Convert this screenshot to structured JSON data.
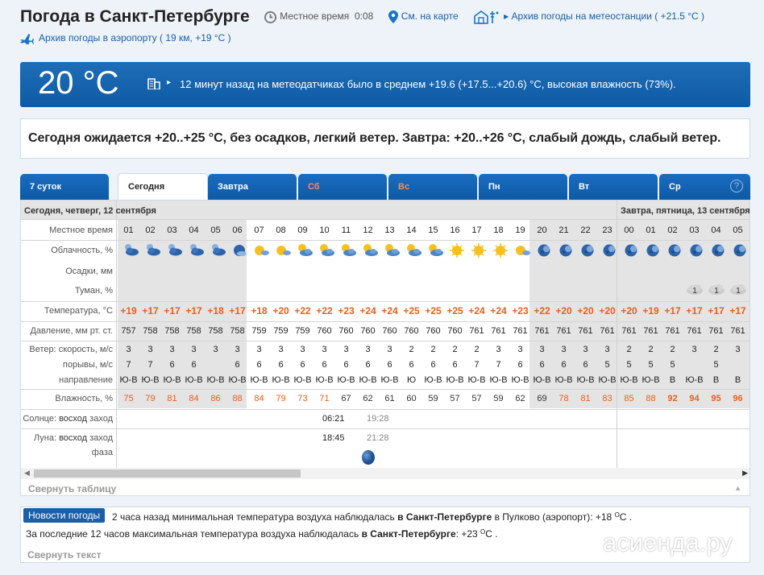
{
  "header": {
    "title": "Погода в Санкт-Петербурге",
    "local_time_label": "Местное время",
    "local_time": "0:08",
    "map_link": "См. на карте",
    "station_link": "Архив погоды на метеостанции ( +21.5 °C )",
    "airport_link": "Архив погоды в аэропорту ( 19 км, +19 °C )"
  },
  "banner": {
    "temperature": "20 °C",
    "arrow": "▸",
    "text": "12 минут назад на метеодатчиках было в среднем +19.6 (+17.5...+20.6) °C, высокая влажность (73%)."
  },
  "forecast": {
    "text": "Сегодня ожидается +20..+25 °C, без осадков, легкий ветер. Завтра: +20..+26 °C, слабый дождь, слабый ветер."
  },
  "tabs": [
    {
      "label": "7 суток"
    },
    {
      "label": "Сегодня"
    },
    {
      "label": "Завтра"
    },
    {
      "label": "Сб"
    },
    {
      "label": "Вс"
    },
    {
      "label": "Пн"
    },
    {
      "label": "Вт"
    },
    {
      "label": "Ср"
    }
  ],
  "help_label": "?",
  "table": {
    "day1_label": "Сегодня, четверг, 12 сентября",
    "day2_label": "Завтра, пятница, 13 сентября",
    "row_labels": {
      "time": "Местное время",
      "clouds": "Облачность, %",
      "precip": "Осадки, мм",
      "fog": "Туман, %",
      "temp": "Температура, °C",
      "pressure": "Давление, мм рт. ст.",
      "wind_speed": "Ветер: скорость, м/с",
      "gusts": "порывы, м/с",
      "direction": "направление",
      "humidity": "Влажность, %",
      "sun": "Солнце:",
      "sun_rise": "восход",
      "sun_set": "заход",
      "moon": "Луна:",
      "moon_rise": "восход",
      "moon_set": "заход",
      "moon_phase": "фаза"
    },
    "hours": [
      "01",
      "02",
      "03",
      "04",
      "05",
      "06",
      "07",
      "08",
      "09",
      "10",
      "11",
      "12",
      "13",
      "14",
      "15",
      "16",
      "17",
      "18",
      "19",
      "20",
      "21",
      "22",
      "23",
      "00",
      "01",
      "02",
      "03",
      "04",
      "05"
    ],
    "cloud_icons": [
      "cloud-moon",
      "cloud-moon",
      "cloud-moon",
      "cloud-moon",
      "cloud-moon",
      "moon-partly",
      "sun-partly",
      "sun-partly",
      "sun-cloud",
      "sun-cloud",
      "sun-cloud",
      "sun-cloud",
      "sun-cloud",
      "sun-cloud",
      "sun-cloud",
      "sun",
      "sun",
      "sun",
      "sun-partly",
      "moon",
      "moon",
      "moon",
      "moon",
      "moon",
      "moon",
      "moon",
      "moon",
      "moon",
      "moon"
    ],
    "fog": [
      "",
      "",
      "",
      "",
      "",
      "",
      "",
      "",
      "",
      "",
      "",
      "",
      "",
      "",
      "",
      "",
      "",
      "",
      "",
      "",
      "",
      "",
      "",
      "",
      "",
      "",
      "1",
      "1",
      "1"
    ],
    "temps": [
      "+19",
      "+17",
      "+17",
      "+17",
      "+18",
      "+17",
      "+18",
      "+20",
      "+22",
      "+22",
      "+23",
      "+24",
      "+24",
      "+25",
      "+25",
      "+25",
      "+24",
      "+24",
      "+23",
      "+22",
      "+20",
      "+20",
      "+20",
      "+20",
      "+19",
      "+17",
      "+17",
      "+17",
      "+17"
    ],
    "pressure": [
      "757",
      "758",
      "758",
      "758",
      "758",
      "758",
      "759",
      "759",
      "759",
      "760",
      "760",
      "760",
      "760",
      "760",
      "760",
      "760",
      "761",
      "761",
      "761",
      "761",
      "761",
      "761",
      "761",
      "761",
      "761",
      "761",
      "761",
      "761",
      "761"
    ],
    "wind": [
      "3",
      "3",
      "3",
      "3",
      "3",
      "3",
      "3",
      "3",
      "3",
      "3",
      "3",
      "3",
      "3",
      "2",
      "2",
      "2",
      "2",
      "3",
      "3",
      "3",
      "3",
      "3",
      "3",
      "2",
      "2",
      "2",
      "3",
      "2",
      "3"
    ],
    "gusts": [
      "7",
      "7",
      "6",
      "6",
      "",
      "6",
      "6",
      "6",
      "6",
      "6",
      "6",
      "6",
      "6",
      "6",
      "6",
      "6",
      "7",
      "7",
      "6",
      "6",
      "6",
      "6",
      "5",
      "5",
      "5",
      "5",
      "",
      "5",
      ""
    ],
    "dir": [
      "Ю-В",
      "Ю-В",
      "Ю-В",
      "Ю-В",
      "Ю-В",
      "Ю-В",
      "Ю-В",
      "Ю-В",
      "Ю-В",
      "Ю-В",
      "Ю-В",
      "Ю-В",
      "Ю-В",
      "Ю",
      "Ю-В",
      "Ю-В",
      "Ю-В",
      "Ю-В",
      "Ю-В",
      "Ю-В",
      "Ю-В",
      "Ю-В",
      "Ю-В",
      "Ю-В",
      "Ю-В",
      "В",
      "Ю-В",
      "В",
      "В"
    ],
    "humidity": [
      "75",
      "79",
      "81",
      "84",
      "86",
      "88",
      "84",
      "79",
      "73",
      "71",
      "67",
      "62",
      "61",
      "60",
      "59",
      "57",
      "57",
      "59",
      "62",
      "69",
      "78",
      "81",
      "83",
      "85",
      "88",
      "92",
      "94",
      "95",
      "96"
    ],
    "sunrise": "06:21",
    "sunset": "19:28",
    "moonrise": "18:45",
    "moonset": "21:28",
    "collapse_label": "Свернуть таблицу"
  },
  "news": {
    "badge": "Новости погоды",
    "line1_a": "2 часа назад минимальная температура воздуха наблюдалась ",
    "line1_city": "в Санкт-Петербурге",
    "line1_b": " в Пулково (аэропорт): +18 ",
    "line1_unit_sup": "O",
    "line1_unit": "C .",
    "line2_a": "За последние 12 часов максимальная температура воздуха наблюдалась ",
    "line2_city": "в Санкт-Петербурге",
    "line2_b": ": +23 ",
    "line2_unit_sup": "O",
    "line2_unit": "C .",
    "collapse_label": "Свернуть текст"
  },
  "watermark": "асиенда.ру",
  "colors": {
    "accent": "#1a5fa8",
    "temp": "#e85f1c",
    "weekend": "#ff8a4a"
  }
}
